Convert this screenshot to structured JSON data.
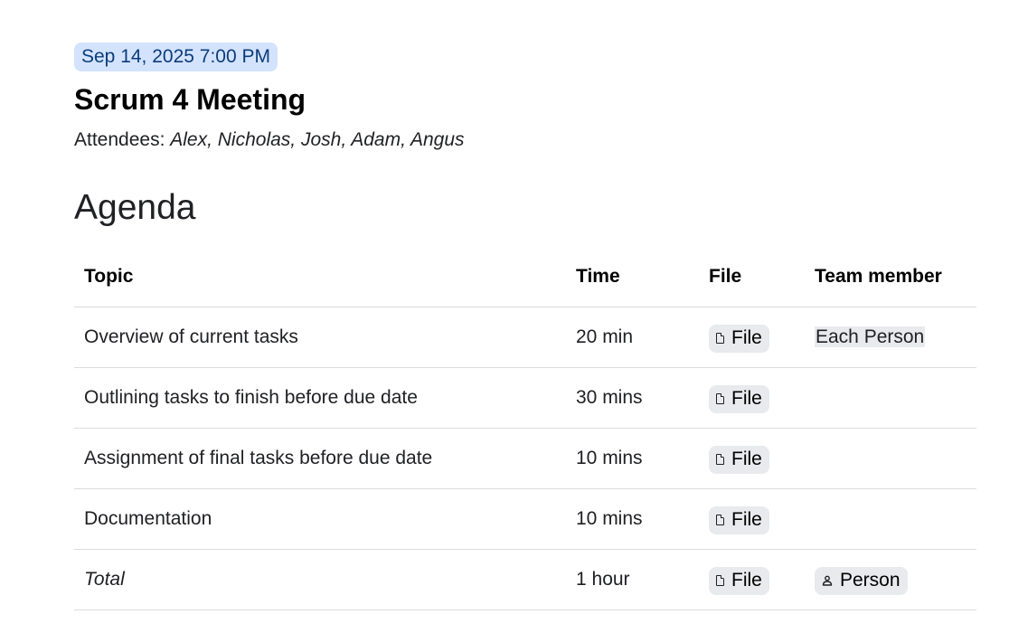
{
  "meeting": {
    "date": "Sep 14, 2025 7:00 PM",
    "title": "Scrum 4 Meeting",
    "attendees_label": "Attendees: ",
    "attendees": "Alex, Nicholas, Josh, Adam, Angus"
  },
  "agenda": {
    "heading": "Agenda",
    "columns": [
      "Topic",
      "Time",
      "File",
      "Team member"
    ],
    "rows": [
      {
        "topic": "Overview of current tasks",
        "time": "20 min",
        "file": "File",
        "member": "Each Person",
        "member_type": "text"
      },
      {
        "topic": "Outlining tasks to finish before due date",
        "time": "30 mins",
        "file": "File",
        "member": "",
        "member_type": "none"
      },
      {
        "topic": "Assignment of final tasks before due date",
        "time": "10 mins",
        "file": "File",
        "member": "",
        "member_type": "none"
      },
      {
        "topic": "Documentation",
        "time": "10 mins",
        "file": "File",
        "member": "",
        "member_type": "none"
      },
      {
        "topic": "Total",
        "time": "1 hour",
        "file": "File",
        "member": "Person",
        "member_type": "chip"
      }
    ]
  },
  "icons": {
    "file_chip_icon": "file-icon",
    "person_chip_icon": "person-icon"
  },
  "colors": {
    "date_chip_bg": "#d3e3fd",
    "date_chip_text": "#0b3c7a",
    "chip_bg": "#e8eaed",
    "divider": "#dadce0"
  }
}
